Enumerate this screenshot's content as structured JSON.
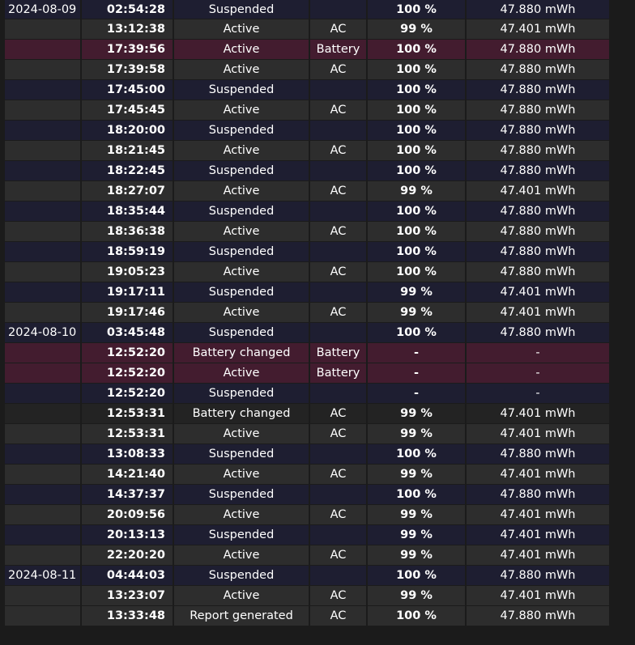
{
  "rows": [
    {
      "date": "2024-08-09",
      "time": "02:54:28",
      "state": "Suspended",
      "source": "",
      "pct": "100 %",
      "cap": "47.880 mWh",
      "kind": "suspended"
    },
    {
      "date": "",
      "time": "13:12:38",
      "state": "Active",
      "source": "AC",
      "pct": "99 %",
      "cap": "47.401 mWh",
      "kind": "active"
    },
    {
      "date": "",
      "time": "17:39:56",
      "state": "Active",
      "source": "Battery",
      "pct": "100 %",
      "cap": "47.880 mWh",
      "kind": "battery"
    },
    {
      "date": "",
      "time": "17:39:58",
      "state": "Active",
      "source": "AC",
      "pct": "100 %",
      "cap": "47.880 mWh",
      "kind": "active"
    },
    {
      "date": "",
      "time": "17:45:00",
      "state": "Suspended",
      "source": "",
      "pct": "100 %",
      "cap": "47.880 mWh",
      "kind": "suspended"
    },
    {
      "date": "",
      "time": "17:45:45",
      "state": "Active",
      "source": "AC",
      "pct": "100 %",
      "cap": "47.880 mWh",
      "kind": "active"
    },
    {
      "date": "",
      "time": "18:20:00",
      "state": "Suspended",
      "source": "",
      "pct": "100 %",
      "cap": "47.880 mWh",
      "kind": "suspended"
    },
    {
      "date": "",
      "time": "18:21:45",
      "state": "Active",
      "source": "AC",
      "pct": "100 %",
      "cap": "47.880 mWh",
      "kind": "active"
    },
    {
      "date": "",
      "time": "18:22:45",
      "state": "Suspended",
      "source": "",
      "pct": "100 %",
      "cap": "47.880 mWh",
      "kind": "suspended"
    },
    {
      "date": "",
      "time": "18:27:07",
      "state": "Active",
      "source": "AC",
      "pct": "99 %",
      "cap": "47.401 mWh",
      "kind": "active"
    },
    {
      "date": "",
      "time": "18:35:44",
      "state": "Suspended",
      "source": "",
      "pct": "100 %",
      "cap": "47.880 mWh",
      "kind": "suspended"
    },
    {
      "date": "",
      "time": "18:36:38",
      "state": "Active",
      "source": "AC",
      "pct": "100 %",
      "cap": "47.880 mWh",
      "kind": "active"
    },
    {
      "date": "",
      "time": "18:59:19",
      "state": "Suspended",
      "source": "",
      "pct": "100 %",
      "cap": "47.880 mWh",
      "kind": "suspended"
    },
    {
      "date": "",
      "time": "19:05:23",
      "state": "Active",
      "source": "AC",
      "pct": "100 %",
      "cap": "47.880 mWh",
      "kind": "active"
    },
    {
      "date": "",
      "time": "19:17:11",
      "state": "Suspended",
      "source": "",
      "pct": "99 %",
      "cap": "47.401 mWh",
      "kind": "suspended"
    },
    {
      "date": "",
      "time": "19:17:46",
      "state": "Active",
      "source": "AC",
      "pct": "99 %",
      "cap": "47.401 mWh",
      "kind": "active"
    },
    {
      "date": "2024-08-10",
      "time": "03:45:48",
      "state": "Suspended",
      "source": "",
      "pct": "100 %",
      "cap": "47.880 mWh",
      "kind": "suspended"
    },
    {
      "date": "",
      "time": "12:52:20",
      "state": "Battery changed",
      "source": "Battery",
      "pct": "-",
      "cap": "-",
      "kind": "battery"
    },
    {
      "date": "",
      "time": "12:52:20",
      "state": "Active",
      "source": "Battery",
      "pct": "-",
      "cap": "-",
      "kind": "battery"
    },
    {
      "date": "",
      "time": "12:52:20",
      "state": "Suspended",
      "source": "",
      "pct": "-",
      "cap": "-",
      "kind": "suspended"
    },
    {
      "date": "",
      "time": "12:53:31",
      "state": "Battery changed",
      "source": "AC",
      "pct": "99 %",
      "cap": "47.401 mWh",
      "kind": "changed"
    },
    {
      "date": "",
      "time": "12:53:31",
      "state": "Active",
      "source": "AC",
      "pct": "99 %",
      "cap": "47.401 mWh",
      "kind": "active"
    },
    {
      "date": "",
      "time": "13:08:33",
      "state": "Suspended",
      "source": "",
      "pct": "100 %",
      "cap": "47.880 mWh",
      "kind": "suspended"
    },
    {
      "date": "",
      "time": "14:21:40",
      "state": "Active",
      "source": "AC",
      "pct": "99 %",
      "cap": "47.401 mWh",
      "kind": "active"
    },
    {
      "date": "",
      "time": "14:37:37",
      "state": "Suspended",
      "source": "",
      "pct": "100 %",
      "cap": "47.880 mWh",
      "kind": "suspended"
    },
    {
      "date": "",
      "time": "20:09:56",
      "state": "Active",
      "source": "AC",
      "pct": "99 %",
      "cap": "47.401 mWh",
      "kind": "active"
    },
    {
      "date": "",
      "time": "20:13:13",
      "state": "Suspended",
      "source": "",
      "pct": "99 %",
      "cap": "47.401 mWh",
      "kind": "suspended"
    },
    {
      "date": "",
      "time": "22:20:20",
      "state": "Active",
      "source": "AC",
      "pct": "99 %",
      "cap": "47.401 mWh",
      "kind": "active"
    },
    {
      "date": "2024-08-11",
      "time": "04:44:03",
      "state": "Suspended",
      "source": "",
      "pct": "100 %",
      "cap": "47.880 mWh",
      "kind": "suspended"
    },
    {
      "date": "",
      "time": "13:23:07",
      "state": "Active",
      "source": "AC",
      "pct": "99 %",
      "cap": "47.401 mWh",
      "kind": "active"
    },
    {
      "date": "",
      "time": "13:33:48",
      "state": "Report generated",
      "source": "AC",
      "pct": "100 %",
      "cap": "47.880 mWh",
      "kind": "active"
    }
  ],
  "colors": {
    "page_background": "#1b1b1b",
    "suspended_row": "#1e1e31",
    "active_row": "#2d2d2d",
    "battery_row": "#431c2f",
    "battery_changed_ac_row": "#232323",
    "text": "#ffffff"
  }
}
